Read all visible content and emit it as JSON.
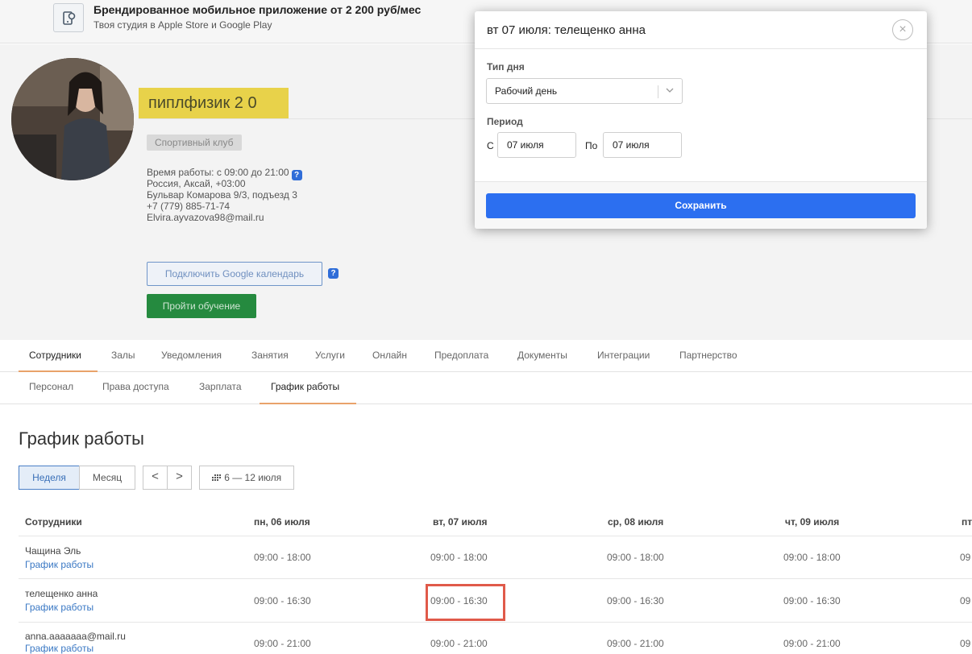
{
  "banner": {
    "title": "Брендированное мобильное приложение от 2 200 руб/мес",
    "subtitle": "Твоя студия в Apple Store и Google Play"
  },
  "profile": {
    "name": "пиплфизик 2 0",
    "tag": "Спортивный клуб",
    "work_hours": "Время работы: с 09:00 до 21:00",
    "location": "Россия, Аксай, +03:00",
    "address": "Бульвар Комарова 9/3, подъезд 3",
    "phone": "+7 (779) 885-71-74",
    "email": "Elvira.ayvazova98@mail.ru",
    "gcal_button": "Подключить Google календарь",
    "learn_button": "Пройти обучение",
    "help_badge": "?"
  },
  "tabs": [
    "Сотрудники",
    "Залы",
    "Уведомления",
    "Занятия",
    "Услуги",
    "Онлайн",
    "Предоплата",
    "Документы",
    "Интеграции",
    "Партнерство"
  ],
  "subtabs": [
    "Персонал",
    "Права доступа",
    "Зарплата",
    "График работы"
  ],
  "page_title": "График работы",
  "view": {
    "week": "Неделя",
    "month": "Месяц",
    "prev": "<",
    "next": ">",
    "range": "6 — 12 июля"
  },
  "table": {
    "headers": [
      "Сотрудники",
      "пн, 06 июля",
      "вт, 07 июля",
      "ср, 08 июля",
      "чт, 09 июля",
      "пт"
    ],
    "rows": [
      {
        "name": "Чащина Эль",
        "link": "График работы",
        "cells": [
          "09:00 - 18:00",
          "09:00 - 18:00",
          "09:00 - 18:00",
          "09:00 - 18:00",
          "09"
        ]
      },
      {
        "name": "телещенко анна",
        "link": "График работы",
        "cells": [
          "09:00 - 16:30",
          "09:00 - 16:30",
          "09:00 - 16:30",
          "09:00 - 16:30",
          "09"
        ]
      },
      {
        "name": "anna.aaaaaaa@mail.ru",
        "link": "График работы",
        "cells": [
          "09:00 - 21:00",
          "09:00 - 21:00",
          "09:00 - 21:00",
          "09:00 - 21:00",
          "09"
        ]
      }
    ]
  },
  "modal": {
    "title": "вт 07 июля: телещенко анна",
    "day_type_label": "Тип дня",
    "day_type_value": "Рабочий день",
    "period_label": "Период",
    "from_label": "С",
    "from_value": "07 июля",
    "to_label": "По",
    "to_value": "07 июля",
    "save_label": "Сохранить",
    "close": "×"
  },
  "colors": {
    "primary": "#2c6ff0",
    "link": "#3a78c4",
    "accent_tab": "#e9a36a",
    "highlight": "#e05a4a",
    "learn_green": "#258a3f"
  }
}
